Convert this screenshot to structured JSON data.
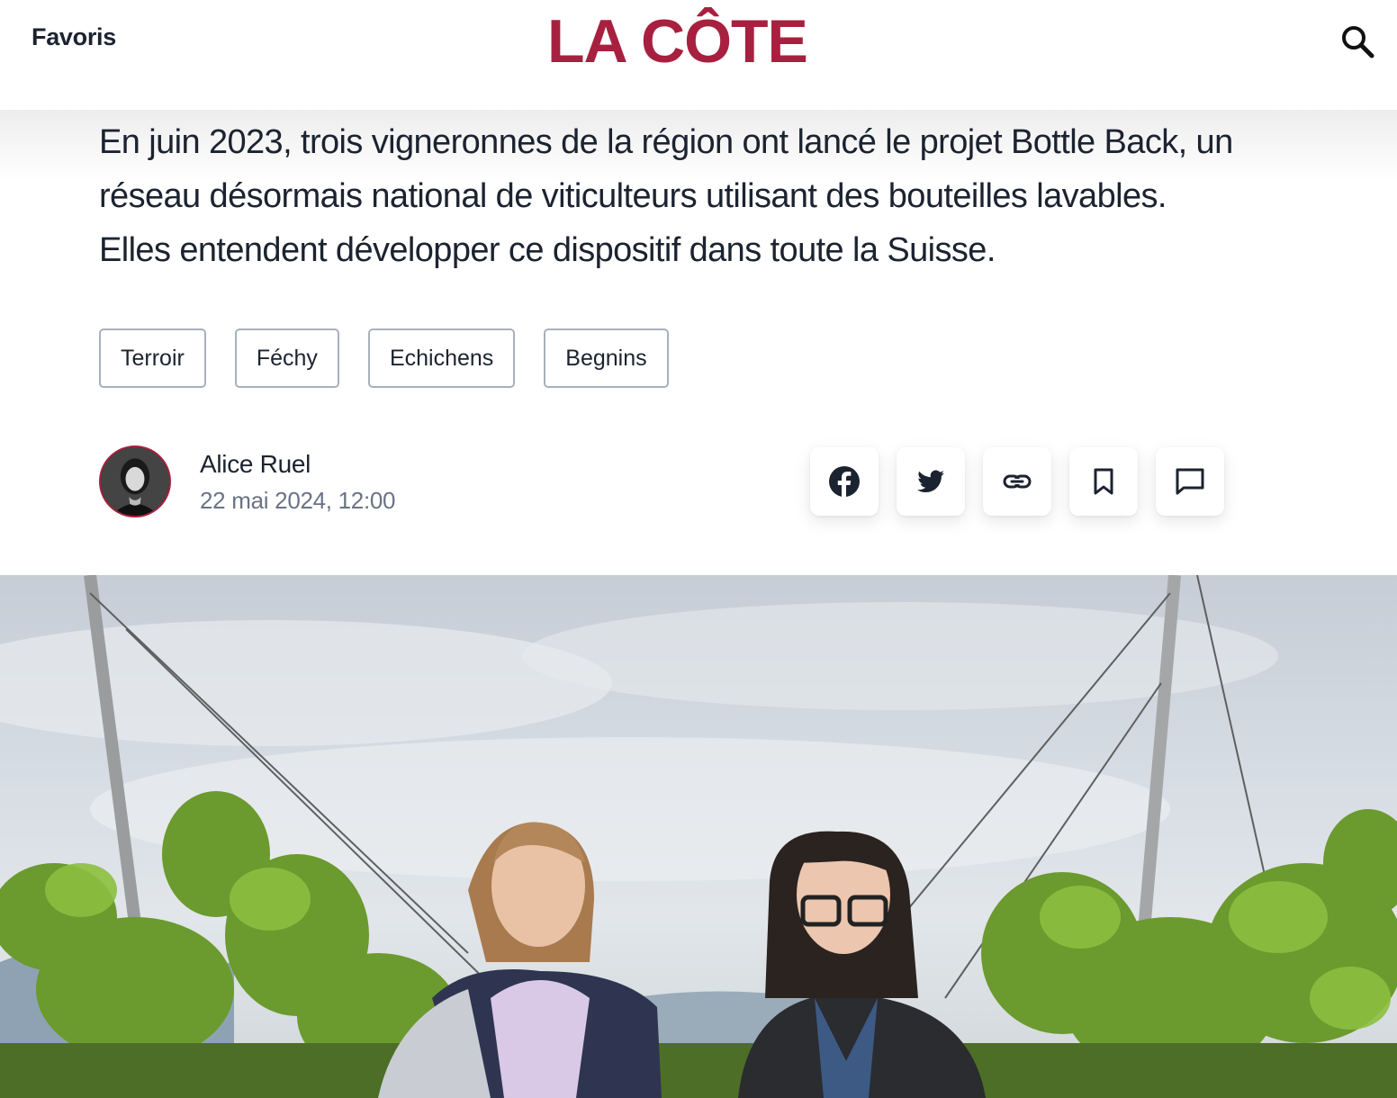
{
  "header": {
    "favoris_label": "Favoris",
    "logo_text": "LA CÔTE",
    "search_icon": "search-icon",
    "brand_color": "#a8203f"
  },
  "article": {
    "lead": "En juin 2023, trois vigneronnes de la région ont lancé le projet Bottle Back, un réseau désormais national de viticulteurs utilisant des bouteilles lavables. Elles entendent développer ce dispositif dans toute la Suisse.",
    "tags": [
      "Terroir",
      "Féchy",
      "Echichens",
      "Begnins"
    ],
    "author": {
      "name": "Alice Ruel",
      "date": "22 mai 2024, 12:00"
    },
    "share_buttons": [
      {
        "icon": "facebook-icon"
      },
      {
        "icon": "twitter-icon"
      },
      {
        "icon": "link-icon"
      },
      {
        "icon": "bookmark-icon"
      },
      {
        "icon": "comment-icon"
      }
    ]
  }
}
